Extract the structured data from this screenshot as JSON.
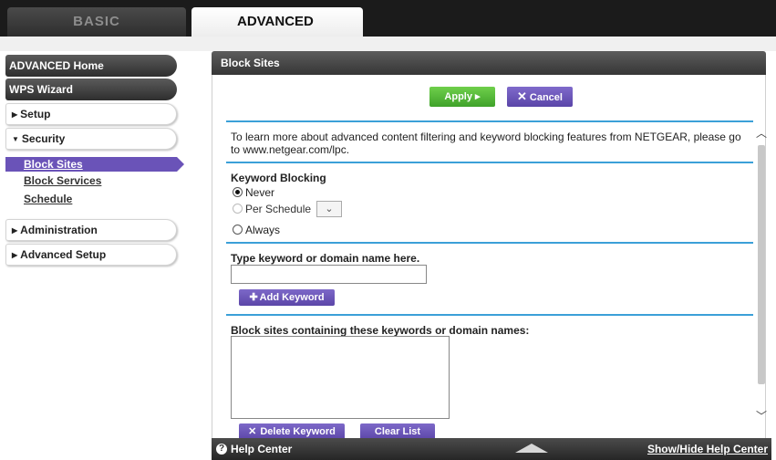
{
  "tabs": {
    "basic": "BASIC",
    "advanced": "ADVANCED"
  },
  "sidebar": {
    "advanced_home": "ADVANCED Home",
    "wps_wizard": "WPS Wizard",
    "setup": "Setup",
    "security": "Security",
    "block_sites": "Block Sites",
    "block_services": "Block Services",
    "schedule": "Schedule",
    "administration": "Administration",
    "advanced_setup": "Advanced Setup"
  },
  "panel": {
    "title": "Block Sites",
    "apply": "Apply ▸",
    "cancel": "Cancel",
    "info": "To learn more about advanced content filtering and keyword blocking features from NETGEAR, please go to www.netgear.com/lpc.",
    "keyword_blocking": {
      "title": "Keyword Blocking",
      "options": [
        "Never",
        "Per Schedule",
        "Always"
      ],
      "selected": "Never"
    },
    "keyword_input": {
      "label": "Type keyword or domain name here.",
      "value": ""
    },
    "add_keyword": "Add Keyword",
    "block_list_label": "Block sites containing these keywords or domain names:",
    "delete_keyword": "Delete Keyword",
    "clear_list": "Clear List"
  },
  "footer": {
    "help_center": "Help Center",
    "show_hide": "Show/Hide Help Center"
  },
  "colors": {
    "accent_purple": "#6a53b8",
    "apply_green": "#4fb82f",
    "rule_blue": "#3ba0d8"
  }
}
